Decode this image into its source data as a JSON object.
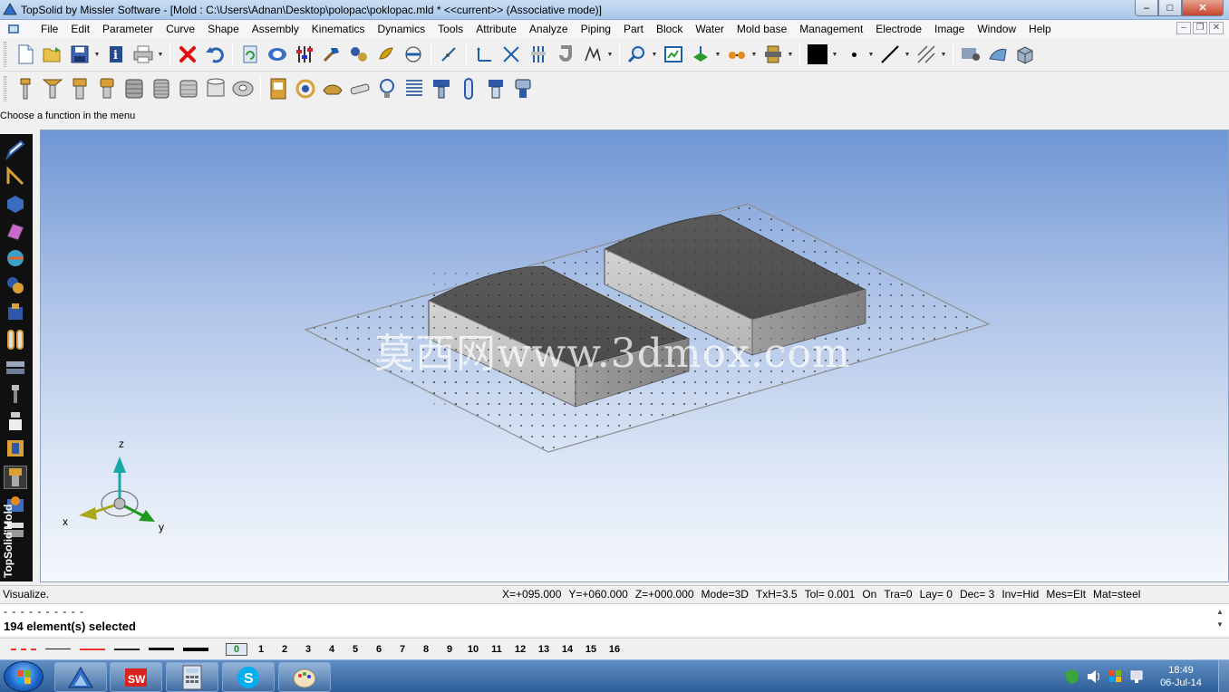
{
  "window": {
    "title": "TopSolid by Missler Software - [Mold : C:\\Users\\Adnan\\Desktop\\polopac\\poklopac.mld *  <<current>> (Associative mode)]",
    "minimize": "–",
    "maximize": "□",
    "close": "✕"
  },
  "menu": [
    "File",
    "Edit",
    "Parameter",
    "Curve",
    "Shape",
    "Assembly",
    "Kinematics",
    "Dynamics",
    "Tools",
    "Attribute",
    "Analyze",
    "Piping",
    "Part",
    "Block",
    "Water",
    "Mold base",
    "Management",
    "Electrode",
    "Image",
    "Window",
    "Help"
  ],
  "mdi": {
    "minimize": "–",
    "restore": "❐",
    "close": "✕"
  },
  "prompt": "Choose a function in the menu",
  "viewport": {
    "watermark": "莫西网www.3dmox.com",
    "axes": {
      "x": "x",
      "y": "y",
      "z": "z"
    }
  },
  "sidebar": {
    "label": "TopSolid'Mold"
  },
  "status": {
    "mode_text": "Visualize.",
    "fields": [
      "X=+095.000",
      "Y=+060.000",
      "Z=+000.000",
      "Mode=3D",
      "TxH=3.5",
      "Tol= 0.001",
      "On",
      "Tra=0",
      "Lay=  0",
      "Dec= 3",
      "Inv=Hid",
      "Mes=Elt",
      "Mat=steel"
    ]
  },
  "messages": {
    "line1": "- - - - - - - - - -",
    "line2": "194 element(s) selected"
  },
  "layers": {
    "active": "0",
    "items": [
      "1",
      "2",
      "3",
      "4",
      "5",
      "6",
      "7",
      "8",
      "9",
      "10",
      "11",
      "12",
      "13",
      "14",
      "15",
      "16"
    ]
  },
  "taskbar": {
    "time": "18:49",
    "date": "06-Jul-14",
    "apps": [
      "topsolid",
      "solidworks",
      "calculator",
      "skype",
      "paint"
    ]
  },
  "colors": {
    "accent": "#1f5faa",
    "close": "#c7432c",
    "viewport_top": "#6f96d4",
    "viewport_bottom": "#f4f7fc",
    "part": "#6b6b6b"
  }
}
